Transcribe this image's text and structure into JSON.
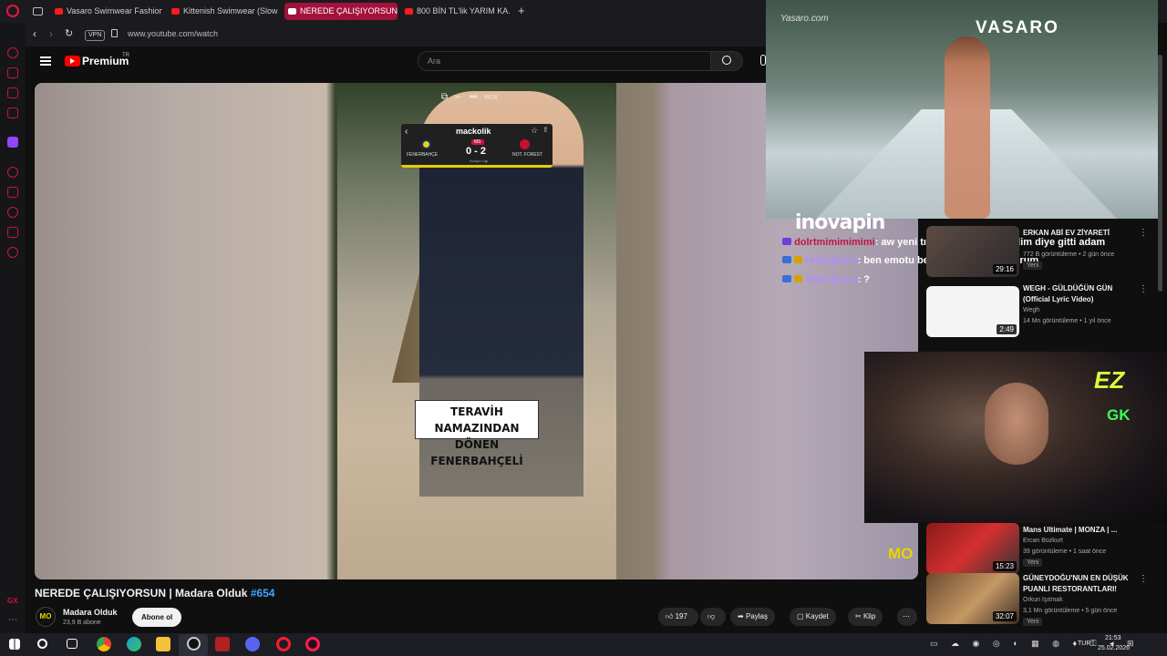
{
  "browser": {
    "tabs": [
      {
        "label": "Vasaro Swimwear Fashion",
        "active": false
      },
      {
        "label": "Kittenish Swimwear (Slow",
        "active": false
      },
      {
        "label": "NEREDE ÇALIŞIYORSUN |",
        "active": true
      },
      {
        "label": "800 BİN TL'lik YARIM KA...",
        "active": false
      }
    ],
    "new_tab": "+",
    "vpn": "VPN",
    "url": "www.youtube.com/watch"
  },
  "youtube": {
    "logo": "Premium",
    "logo_sup": "TR",
    "search_placeholder": "Ara"
  },
  "video": {
    "player_controls": [
      "⧉",
      "⇤",
      "⏭"
    ],
    "player_ctrl_text": "RDX",
    "scoreboard": {
      "brand": "mackolik",
      "home": "FENERBAHÇE",
      "away": "NOT. FOREST",
      "score": "0 - 2",
      "status": "MS",
      "league": "Avrupa Ligi"
    },
    "caption_line1": "TERAVİH NAMAZINDAN",
    "caption_line2": "DÖNEN FENERBAHÇELİ",
    "watermark": "MO",
    "title": "NEREDE ÇALIŞIYORSUN | Madara Olduk",
    "hashtag": "#654",
    "channel": "Madara Olduk",
    "channel_avatar": "MO",
    "subscribers": "23,9 B abone",
    "subscribe": "Abone ol",
    "likes": "197",
    "share": "Paylaş",
    "save": "Kaydet",
    "clip": "Klip"
  },
  "overlay": {
    "brand": "VASARO",
    "site_watermark": "Yasaro.com",
    "inovapin": "inovapin",
    "ez": "EZ",
    "ez2": "GK"
  },
  "chat": [
    {
      "user": "dolrtmimimimimi",
      "text": ": aw yeni tıkladım sırf ben geldim diye gitti adam"
    },
    {
      "user": "Hidrojennx",
      "text": ": ben emotu beğendiğim için atıyorum"
    },
    {
      "user": "Hidrojennx",
      "text": ": ?"
    }
  ],
  "recommendations": [
    {
      "title": "ERKAN ABİ EV ZİYARETİ",
      "meta": "772 B görüntüleme • 2 gün önce",
      "duration": "29:16",
      "badge": "Yeni"
    },
    {
      "title": "WEGH - GÜLDÜĞÜN GÜN (Official Lyric Video)",
      "channel": "Wegh",
      "meta": "14 Mn görüntüleme • 1 yıl önce",
      "duration": "2:49"
    },
    {
      "title": "Mans Ultimate | MONZA | ...",
      "channel": "Ercan Bozkurt",
      "meta": "39 görüntüleme • 1 saat önce",
      "duration": "15:23",
      "badge": "Yeni"
    },
    {
      "title": "GÜNEYDOĞU'NUN EN DÜŞÜK PUANLI RESTORANTLARI!",
      "channel": "Orkun Işıtmak",
      "meta": "3,1 Mn görüntüleme • 5 gün önce",
      "duration": "32:07",
      "badge": "Yeni"
    }
  ],
  "taskbar": {
    "lang": "TUR",
    "time": "21:53",
    "date": "25.02.2026",
    "sidebar_label": "GX"
  },
  "colors": {
    "accent": "#c8163f",
    "yt_red": "#ff0000",
    "link": "#3ea6ff"
  }
}
